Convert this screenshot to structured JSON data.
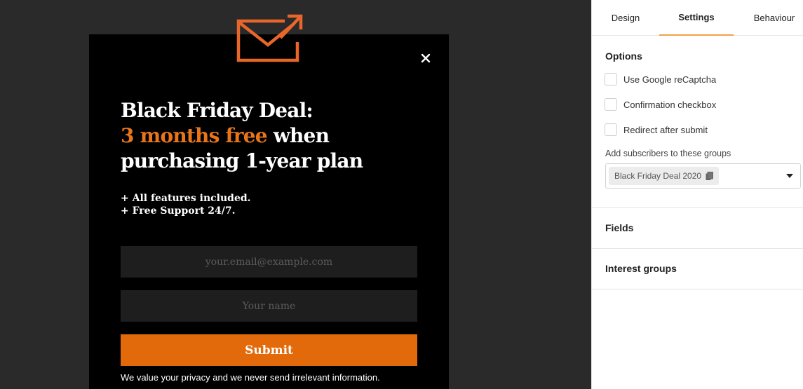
{
  "popup": {
    "headline_line1": "Black Friday Deal:",
    "headline_accent": "3 months free",
    "headline_line2_rest": "when",
    "headline_line3": "purchasing 1-year plan",
    "features": [
      "+ All features included.",
      "+ Free Support 24/7."
    ],
    "email_placeholder": "your.email@example.com",
    "name_placeholder": "Your name",
    "submit_label": "Submit",
    "privacy_text": "We value your privacy and we never send irrelevant information.",
    "close_glyph": "✕"
  },
  "panel": {
    "tabs": [
      {
        "label": "Design",
        "active": false
      },
      {
        "label": "Settings",
        "active": true
      },
      {
        "label": "Behaviour",
        "active": false
      }
    ],
    "options_title": "Options",
    "options": [
      {
        "label": "Use Google reCaptcha",
        "checked": false
      },
      {
        "label": "Confirmation checkbox",
        "checked": false
      },
      {
        "label": "Redirect after submit",
        "checked": false
      }
    ],
    "groups_label": "Add subscribers to these groups",
    "selected_group": "Black Friday Deal 2020",
    "fields_title": "Fields",
    "interest_groups_title": "Interest groups"
  },
  "colors": {
    "accent": "#e8751a",
    "submit_bg": "#e26a0a",
    "tab_underline": "#f3a047",
    "canvas_bg": "#2a2a2a",
    "popup_bg": "#000000"
  },
  "icons": {
    "logo": "envelope-arrow-icon",
    "close": "close-icon",
    "copy": "copy-icon",
    "dropdown": "chevron-down-icon"
  }
}
